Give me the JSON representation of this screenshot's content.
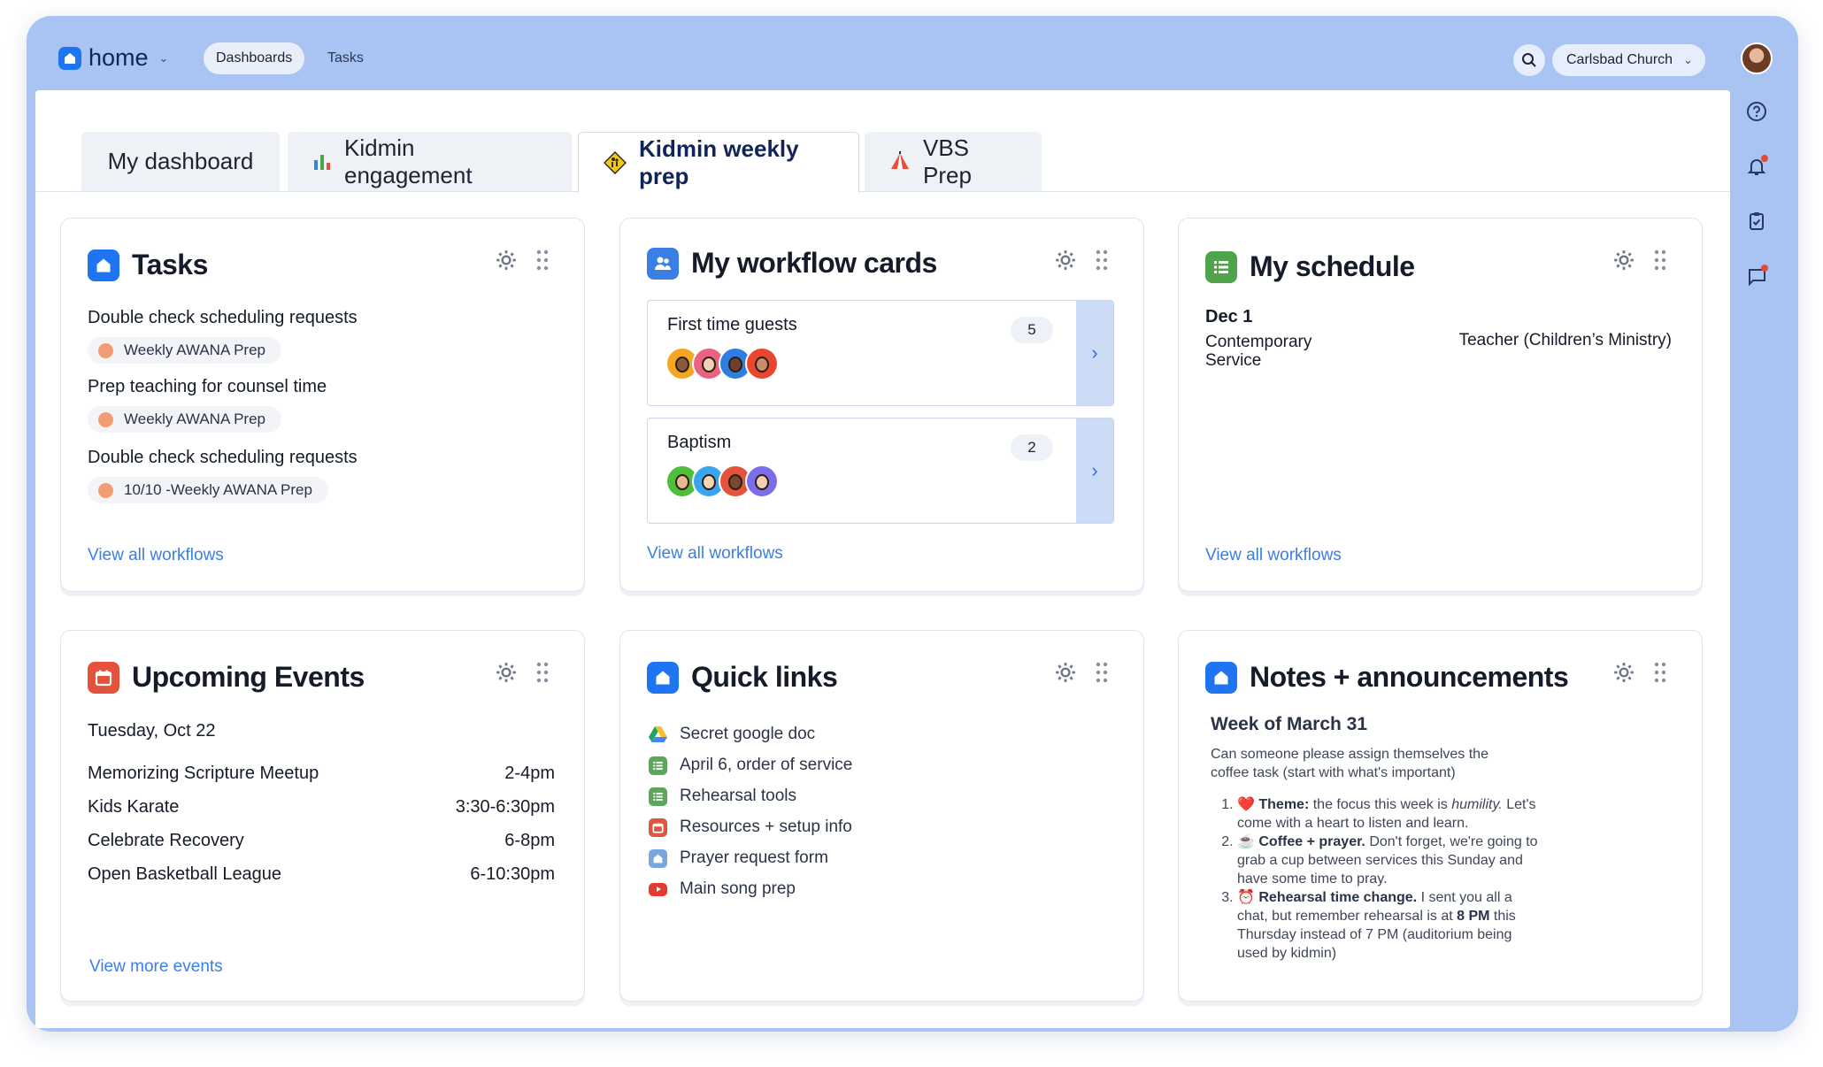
{
  "topbar": {
    "app_name": "home",
    "nav": [
      "Dashboards",
      "Tasks"
    ],
    "org": "Carlsbad Church"
  },
  "tabs": [
    "My dashboard",
    "Kidmin engagement",
    "Kidmin weekly prep",
    "VBS Prep"
  ],
  "active_tab": "Kidmin weekly prep",
  "tasks_card": {
    "title": "Tasks",
    "items": [
      {
        "title": "Double check scheduling requests",
        "chip": "Weekly AWANA Prep"
      },
      {
        "title": "Prep teaching for counsel time",
        "chip": "Weekly AWANA Prep"
      },
      {
        "title": "Double check scheduling requests",
        "chip": "10/10 -Weekly AWANA Prep"
      }
    ],
    "link": "View all workflows"
  },
  "workflow_card": {
    "title": "My workflow cards",
    "items": [
      {
        "name": "First time guests",
        "count": "5"
      },
      {
        "name": "Baptism",
        "count": "2"
      }
    ],
    "link": "View all workflows"
  },
  "schedule_card": {
    "title": "My schedule",
    "date": "Dec 1",
    "service": "Contemporary Service",
    "role": "Teacher (Children’s Ministry)",
    "link": "View all workflows"
  },
  "events_card": {
    "title": "Upcoming Events",
    "date": "Tuesday, Oct 22",
    "events": [
      {
        "name": "Memorizing Scripture Meetup",
        "time": "2-4pm"
      },
      {
        "name": "Kids Karate",
        "time": "3:30-6:30pm"
      },
      {
        "name": "Celebrate Recovery",
        "time": "6-8pm"
      },
      {
        "name": "Open Basketball League",
        "time": "6-10:30pm"
      }
    ],
    "link": "View more events"
  },
  "quicklinks_card": {
    "title": "Quick links",
    "links": [
      {
        "label": "Secret google doc",
        "icon": "google-drive-icon"
      },
      {
        "label": "April 6, order of service",
        "icon": "list-icon"
      },
      {
        "label": "Rehearsal tools",
        "icon": "list-icon"
      },
      {
        "label": "Resources + setup info",
        "icon": "calendar-icon"
      },
      {
        "label": "Prayer request form",
        "icon": "home-icon"
      },
      {
        "label": "Main song prep",
        "icon": "youtube-icon"
      }
    ]
  },
  "notes_card": {
    "title": "Notes + announcements",
    "week": "Week of March 31",
    "intro": "Can someone please assign themselves the coffee task (start with what's important)",
    "items": [
      {
        "emoji": "❤️",
        "label": "Theme:",
        "text_a": " the focus this week is ",
        "em": "humility.",
        "text_b": " Let's come with a heart to listen and learn."
      },
      {
        "emoji": "☕",
        "label": "Coffee + prayer.",
        "text_a": " Don't forget, we're going to grab a cup between services this Sunday and have some time to pray."
      },
      {
        "emoji": "⏰",
        "label": "Rehearsal time change.",
        "text_a": " I sent you all a chat, but remember rehearsal is at ",
        "strong": "8 PM",
        "text_b": " this Thursday instead of 7 PM (auditorium being used by kidmin)"
      }
    ]
  },
  "colors": {
    "frame": "#a9c4f3",
    "accent_blue": "#1f74f2",
    "link": "#3b7ee6",
    "schedule_green": "#4fa34a",
    "events_red": "#e4523b"
  }
}
